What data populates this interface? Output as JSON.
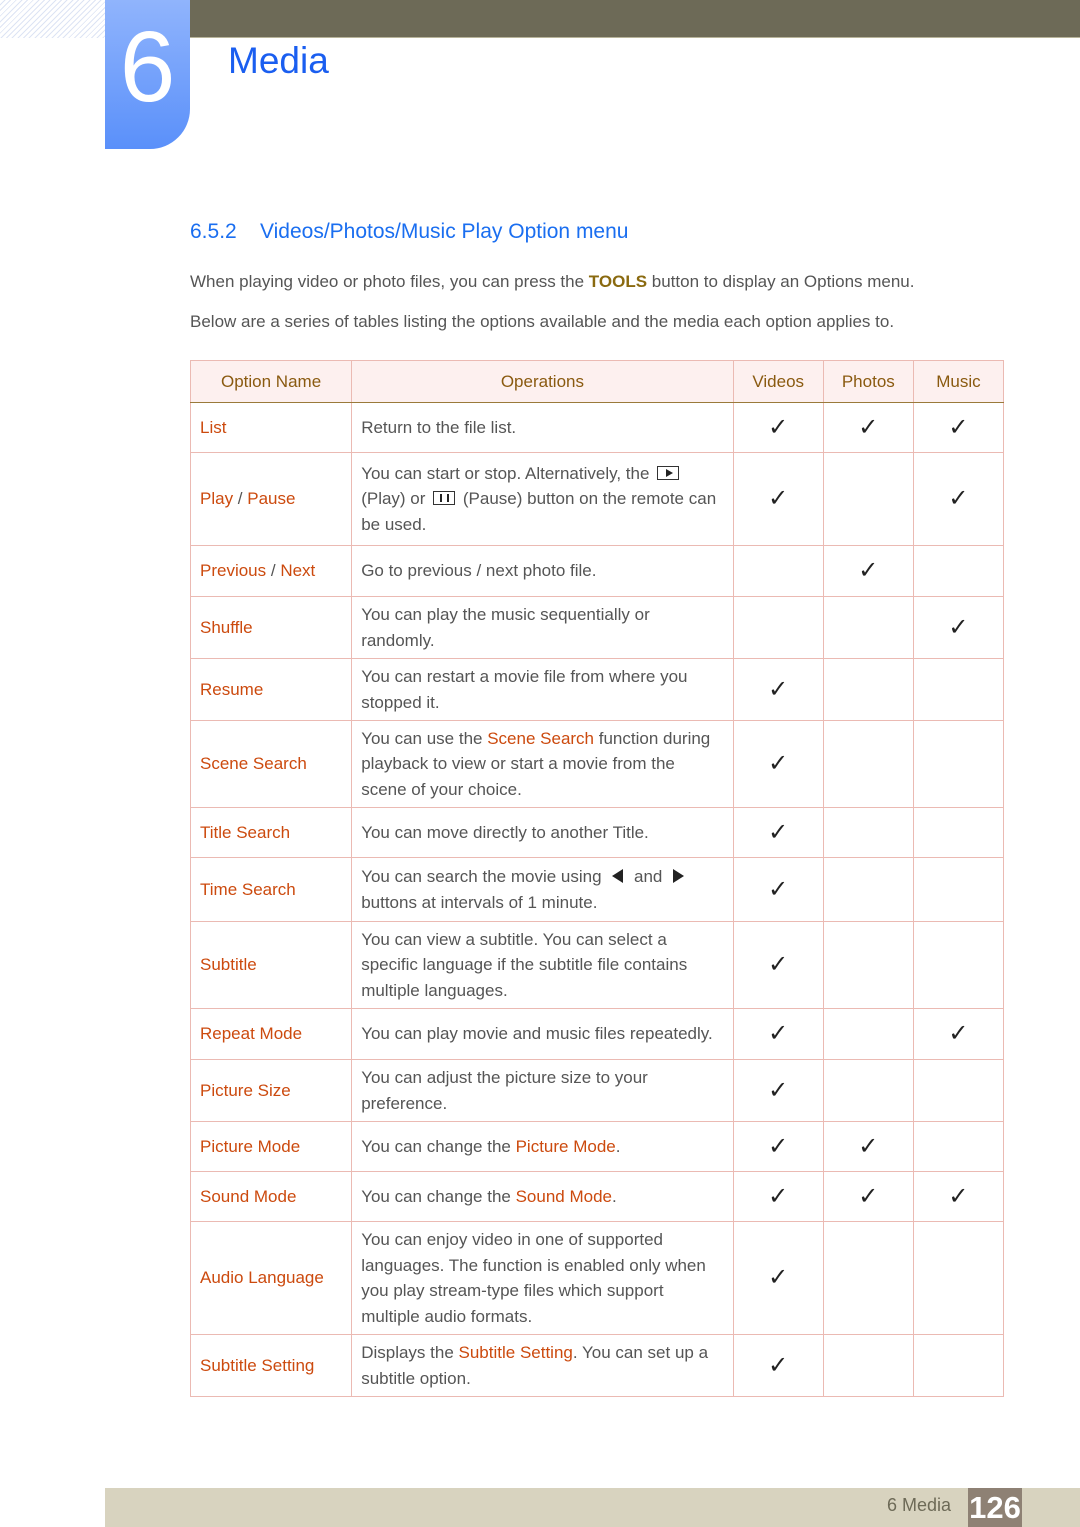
{
  "chapter": {
    "number": "6",
    "title": "Media"
  },
  "section": {
    "number": "6.5.2",
    "title": "Videos/Photos/Music Play Option menu"
  },
  "intro": [
    [
      {
        "t": "When playing video or photo files, you can press the "
      },
      {
        "t": "TOOLS",
        "b": true
      },
      {
        "t": " button to display an Options menu."
      }
    ],
    [
      {
        "t": "Below are a series of tables listing the options available and the media each option applies to."
      }
    ]
  ],
  "table": {
    "headers": [
      "Option Name",
      "Operations",
      "Videos",
      "Photos",
      "Music"
    ],
    "check_glyph": "✓",
    "rows": [
      {
        "name": [
          {
            "t": "List"
          }
        ],
        "ops": [
          {
            "t": "Return to the file list."
          }
        ],
        "videos": true,
        "photos": true,
        "music": true
      },
      {
        "name": [
          {
            "t": "Play"
          },
          {
            "t": " / ",
            "s": true
          },
          {
            "t": "Pause"
          }
        ],
        "ops": [
          {
            "t": "You can start or stop. Alternatively, the "
          },
          {
            "icon": "play-button-icon"
          },
          {
            "t": " (Play) or "
          },
          {
            "icon": "pause-button-icon"
          },
          {
            "t": " (Pause) button on the remote can be used."
          }
        ],
        "videos": true,
        "photos": false,
        "music": true
      },
      {
        "name": [
          {
            "t": "Previous"
          },
          {
            "t": " / ",
            "s": true
          },
          {
            "t": "Next"
          }
        ],
        "ops": [
          {
            "t": "Go to previous / next photo file."
          }
        ],
        "videos": false,
        "photos": true,
        "music": false
      },
      {
        "name": [
          {
            "t": "Shuffle"
          }
        ],
        "ops": [
          {
            "t": "You can play the music sequentially or randomly."
          }
        ],
        "videos": false,
        "photos": false,
        "music": true
      },
      {
        "name": [
          {
            "t": "Resume"
          }
        ],
        "ops": [
          {
            "t": "You can restart a movie file from where you stopped it."
          }
        ],
        "videos": true,
        "photos": false,
        "music": false
      },
      {
        "name": [
          {
            "t": "Scene Search"
          }
        ],
        "ops": [
          {
            "t": "You can use the "
          },
          {
            "t": "Scene Search",
            "hl": true
          },
          {
            "t": " function during playback to view or start a movie from the scene of your choice."
          }
        ],
        "videos": true,
        "photos": false,
        "music": false
      },
      {
        "name": [
          {
            "t": "Title Search"
          }
        ],
        "ops": [
          {
            "t": "You can move directly to another Title."
          }
        ],
        "videos": true,
        "photos": false,
        "music": false
      },
      {
        "name": [
          {
            "t": "Time Search"
          }
        ],
        "ops": [
          {
            "t": "You can search the movie using "
          },
          {
            "icon": "left-arrow-icon"
          },
          {
            "t": " and "
          },
          {
            "icon": "right-arrow-icon"
          },
          {
            "t": " buttons at intervals of 1 minute."
          }
        ],
        "videos": true,
        "photos": false,
        "music": false
      },
      {
        "name": [
          {
            "t": "Subtitle"
          }
        ],
        "ops": [
          {
            "t": "You can view a subtitle. You can select a specific language if the subtitle file contains multiple languages."
          }
        ],
        "videos": true,
        "photos": false,
        "music": false
      },
      {
        "name": [
          {
            "t": "Repeat Mode"
          }
        ],
        "ops": [
          {
            "t": "You can play movie and music files repeatedly."
          }
        ],
        "videos": true,
        "photos": false,
        "music": true
      },
      {
        "name": [
          {
            "t": "Picture Size"
          }
        ],
        "ops": [
          {
            "t": "You can adjust the picture size to your preference."
          }
        ],
        "videos": true,
        "photos": false,
        "music": false
      },
      {
        "name": [
          {
            "t": "Picture Mode"
          }
        ],
        "ops": [
          {
            "t": "You can change the "
          },
          {
            "t": "Picture Mode",
            "hl": true
          },
          {
            "t": "."
          }
        ],
        "videos": true,
        "photos": true,
        "music": false
      },
      {
        "name": [
          {
            "t": "Sound Mode"
          }
        ],
        "ops": [
          {
            "t": "You can change the "
          },
          {
            "t": "Sound Mode",
            "hl": true
          },
          {
            "t": "."
          }
        ],
        "videos": true,
        "photos": true,
        "music": true
      },
      {
        "name": [
          {
            "t": "Audio Language"
          }
        ],
        "ops": [
          {
            "t": "You can enjoy video in one of supported languages. The function is enabled only when you play stream-type files which support multiple audio formats."
          }
        ],
        "videos": true,
        "photos": false,
        "music": false
      },
      {
        "name": [
          {
            "t": "Subtitle Setting"
          }
        ],
        "ops": [
          {
            "t": "Displays the "
          },
          {
            "t": "Subtitle Setting",
            "hl": true
          },
          {
            "t": ". You can set up a subtitle option."
          }
        ],
        "videos": true,
        "photos": false,
        "music": false
      }
    ]
  },
  "footer": {
    "label": "6 Media",
    "page": "126"
  },
  "colors": {
    "accent_blue": "#1a5ef0",
    "option_orange": "#cc4a0e",
    "header_text": "#8a5a10",
    "topbar": "#6d6a57"
  }
}
